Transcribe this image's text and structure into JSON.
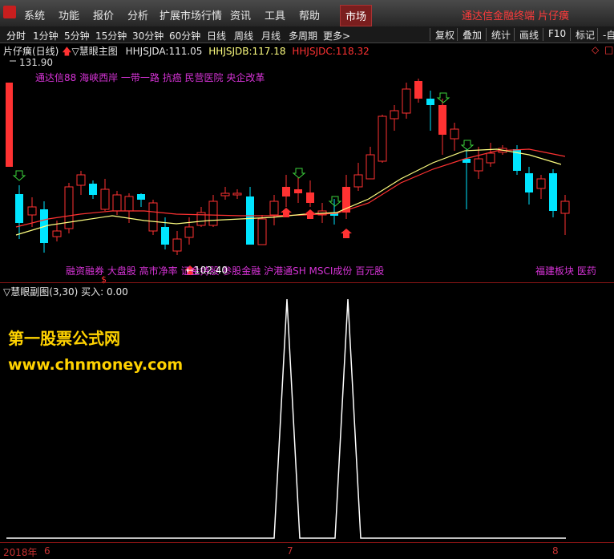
{
  "menubar": {
    "items": [
      "系统",
      "功能",
      "报价",
      "分析",
      "扩展市场行情",
      "资讯",
      "工具",
      "帮助"
    ],
    "market_button": "市场",
    "terminal_title": "通达信金融终端",
    "user": "片仔癀"
  },
  "periodbar": {
    "periods": [
      "分时",
      "1分钟",
      "5分钟",
      "15分钟",
      "30分钟",
      "60分钟",
      "日线",
      "周线",
      "月线",
      "多周期",
      "更多>"
    ],
    "tools": [
      "复权",
      "叠加",
      "统计",
      "画线",
      "F10",
      "标记",
      "-自"
    ]
  },
  "main_chart": {
    "stock_label": "片仔癀(日线)",
    "indicator_name": "慧眼主图",
    "hhjsjda_label": "HHJSJDA:",
    "hhjsjda_value": "111.05",
    "hhjsjdb_label": "HHJSJDB:",
    "hhjsjdb_value": "117.18",
    "hhjsjdc_label": "HHJSJDC:",
    "hhjsjdc_value": "118.32",
    "high_price": "131.90",
    "low_price": "102.40",
    "top_tags": "通达信88 海峡西岸 一带一路 抗癌 民营医院 央企改革",
    "bottom_tags": "融资融券 大盘股 高市净率 证金持股 参股金融 沪港通SH MSCI成份 百元股",
    "right_tags": "福建板块 医药",
    "dollar_mark": "$"
  },
  "sub_chart": {
    "indicator_name": "慧眼副图(3,30)",
    "buy_label": "买入:",
    "buy_value": "0.00"
  },
  "watermark": {
    "site_name": "第一股票公式网",
    "url": "www.chnmoney.com"
  },
  "datebar": {
    "year_label": "2018年",
    "month_6": "6",
    "month_7": "7",
    "month_8": "8"
  },
  "colors": {
    "up_candle": "#ff3232",
    "down_candle": "#00e5ff",
    "ma_short": "#ffff80",
    "ma_long": "#ff3232",
    "signal_line": "#ffffff",
    "accent": "#d633d6"
  }
}
